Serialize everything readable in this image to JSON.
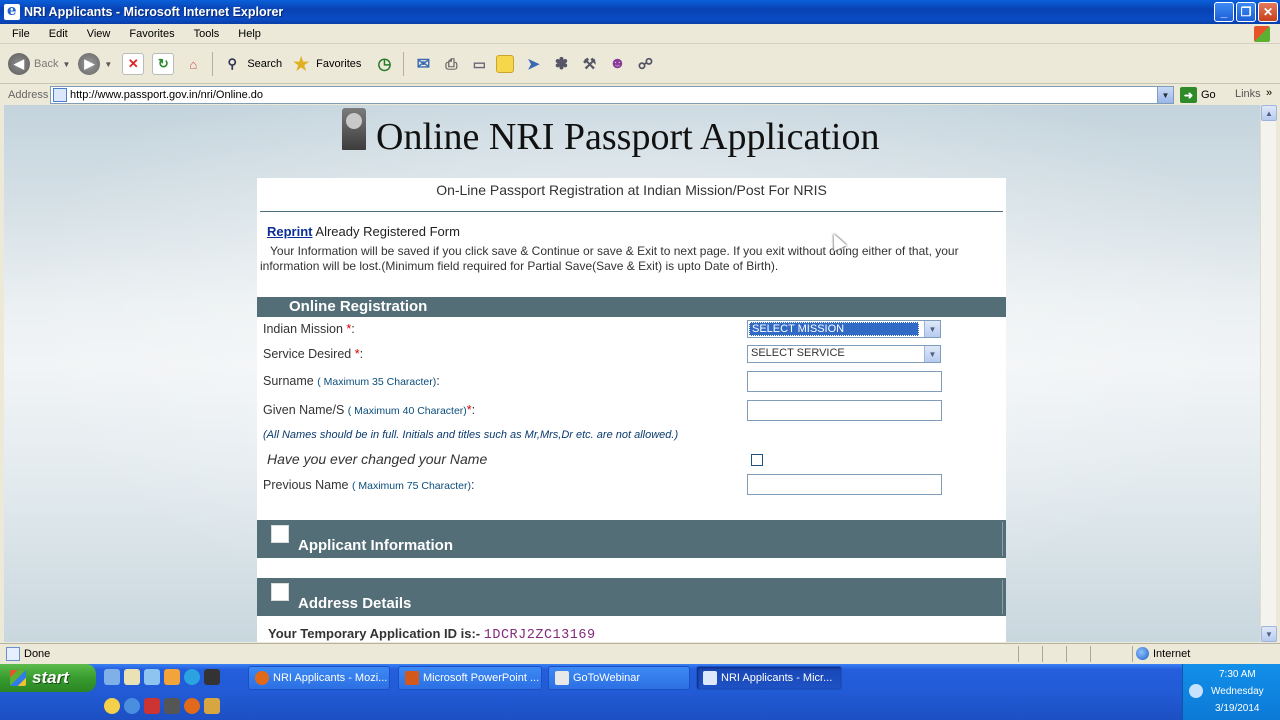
{
  "window": {
    "title": "NRI  Applicants - Microsoft Internet Explorer"
  },
  "menu": [
    "File",
    "Edit",
    "View",
    "Favorites",
    "Tools",
    "Help"
  ],
  "toolbar": {
    "back": "Back",
    "search": "Search",
    "favorites": "Favorites"
  },
  "address": {
    "label": "Address",
    "url": "http://www.passport.gov.in/nri/Online.do",
    "go": "Go",
    "links": "Links"
  },
  "page": {
    "heading": "Online NRI Passport Application",
    "subheading": "On-Line Passport Registration at Indian Mission/Post For NRIS",
    "reprint_link": "Reprint",
    "reprint_rest": "Already Registered Form",
    "info": "Your Information will be saved if you click save & Continue or save & Exit to next page. If you exit without  doing either of that, your information will be lost.(Minimum field required for Partial Save(Save & Exit) is upto  Date of Birth).",
    "section_registration": "Online Registration",
    "fields": {
      "mission_label": "Indian Mission",
      "mission_value": "SELECT MISSION",
      "service_label": "Service Desired",
      "service_value": "SELECT SERVICE",
      "surname_label": "Surname",
      "surname_hint": "( Maximum 35 Character)",
      "given_label": "Given Name/S",
      "given_hint": "( Maximum 40 Character)",
      "previous_label": "Previous Name",
      "previous_hint": "( Maximum 75 Character)",
      "required_mark": "*",
      "colon": ":"
    },
    "names_note": "(All Names should be in full. Initials and titles such as Mr,Mrs,Dr etc. are not allowed.)",
    "changed_name_question": "Have you ever changed your Name",
    "section_applicant": "Applicant Information",
    "section_address": "Address Details",
    "temp_id_label": "Your Temporary Application ID is:-",
    "temp_id_value": "1DCRJ2ZC13169"
  },
  "status": {
    "text": "Done",
    "zone": "Internet"
  },
  "taskbar": {
    "start": "start",
    "tasks": [
      "NRI Applicants - Mozi...",
      "Microsoft PowerPoint ...",
      "GoToWebinar",
      "NRI  Applicants - Micr..."
    ],
    "time": "7:30 AM",
    "day": "Wednesday",
    "date": "3/19/2014"
  }
}
